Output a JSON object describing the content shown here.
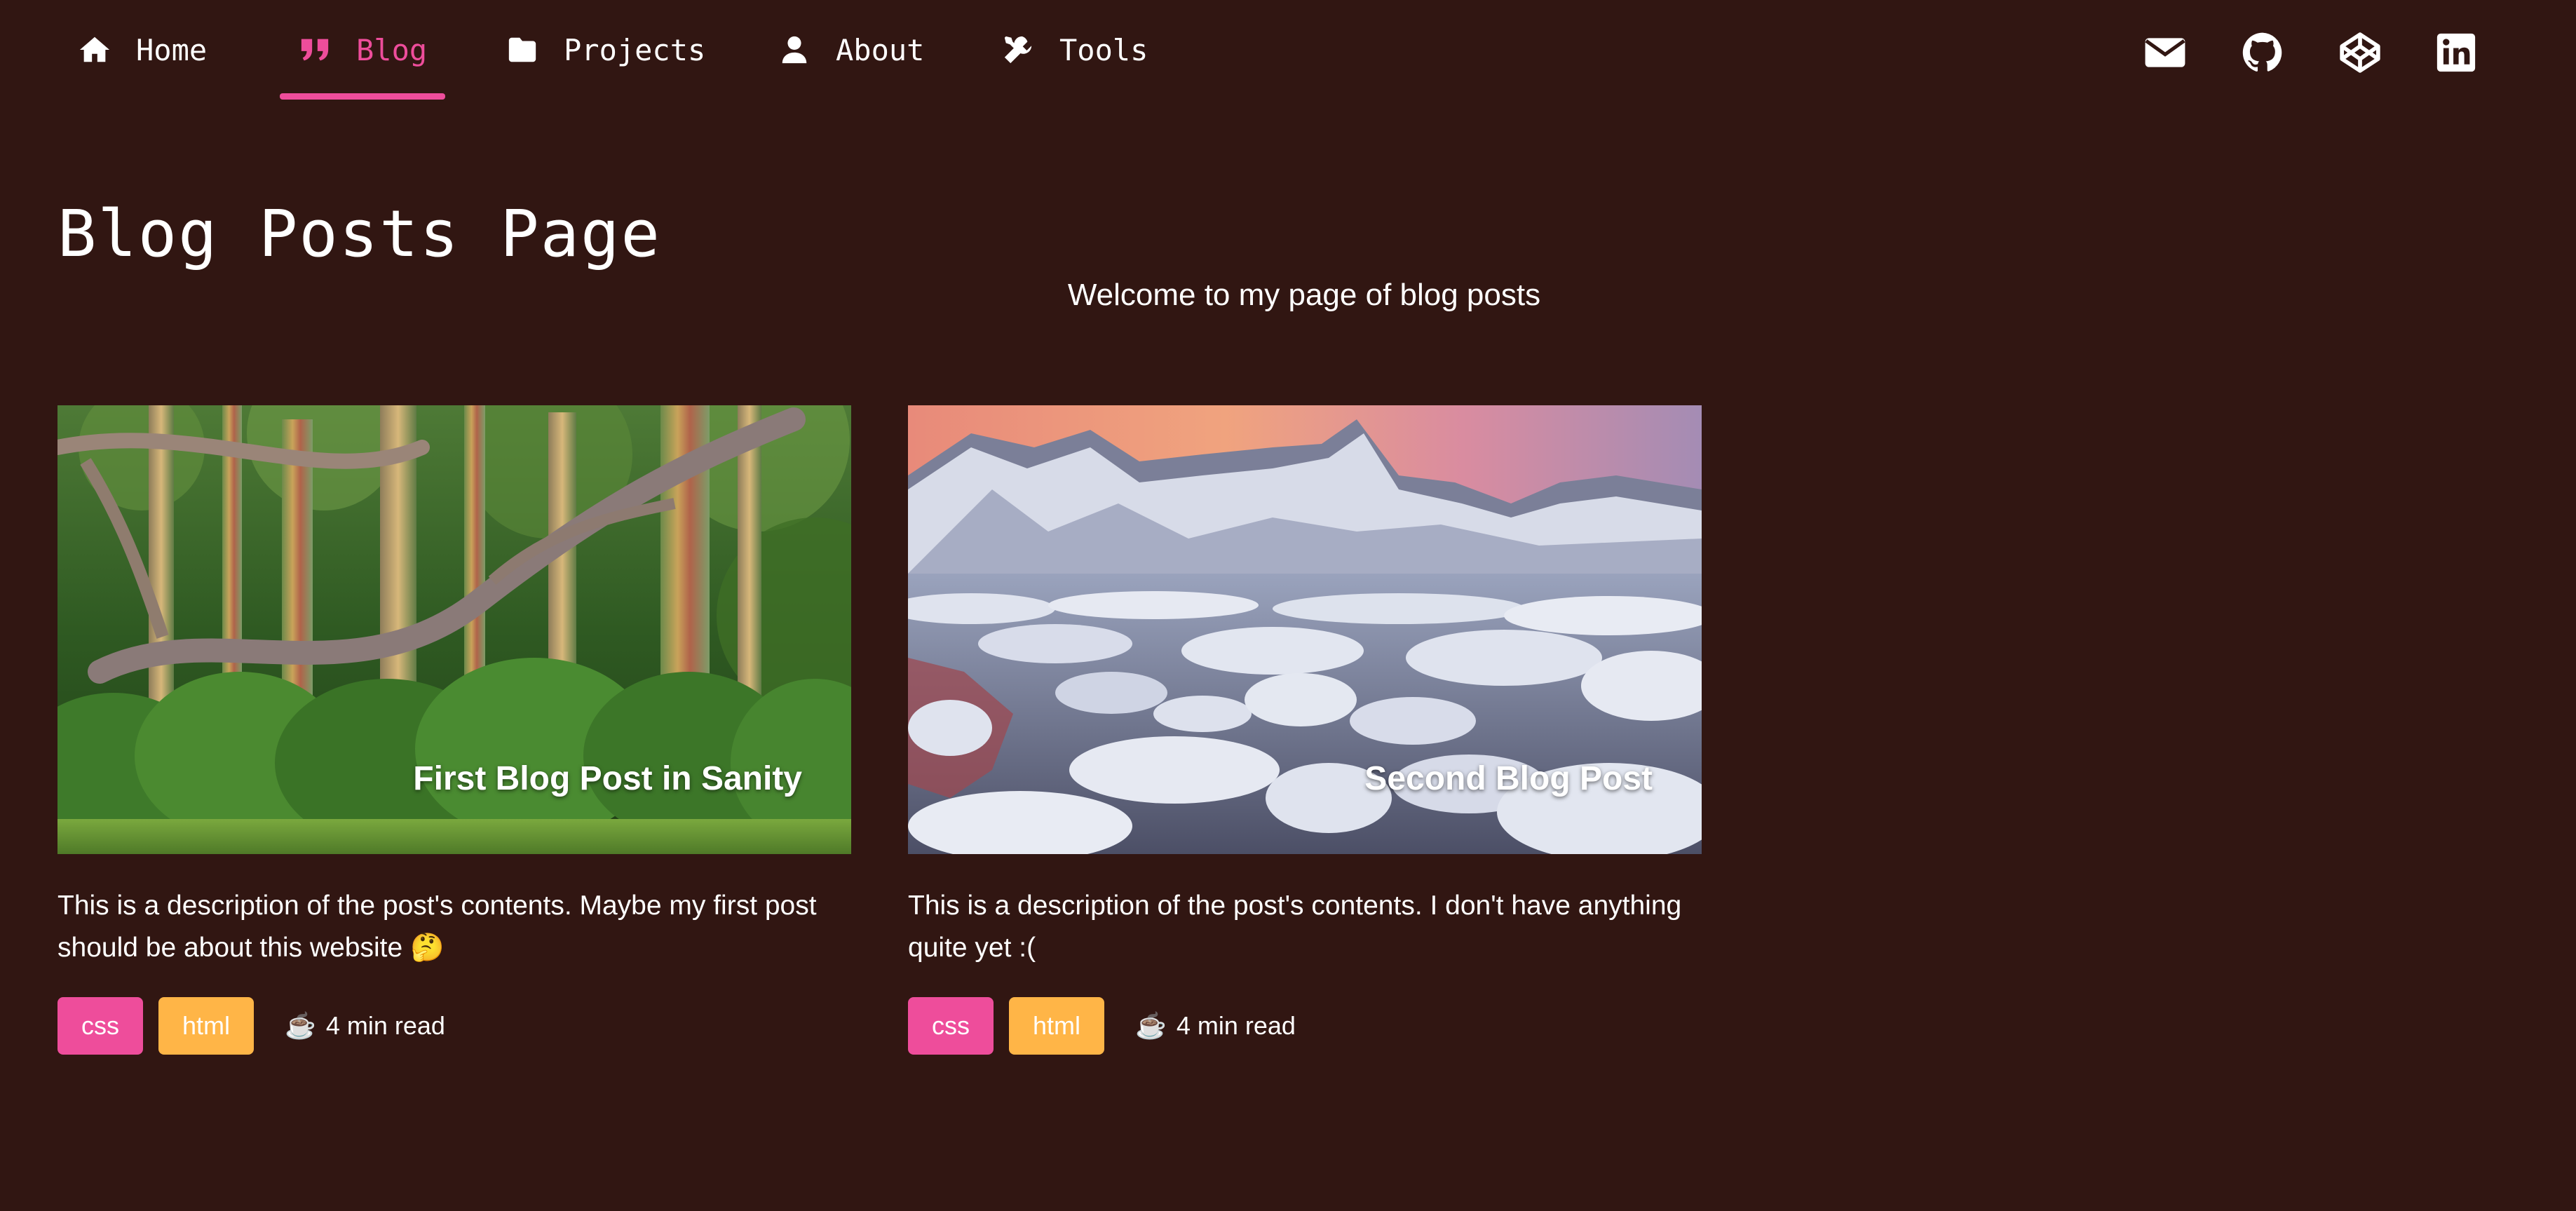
{
  "nav": {
    "items": [
      {
        "label": "Home",
        "icon": "home-icon"
      },
      {
        "label": "Blog",
        "icon": "quote-icon",
        "active": true
      },
      {
        "label": "Projects",
        "icon": "folder-icon"
      },
      {
        "label": "About",
        "icon": "user-icon"
      },
      {
        "label": "Tools",
        "icon": "tools-icon"
      }
    ],
    "social": [
      "mail-icon",
      "github-icon",
      "codepen-icon",
      "linkedin-icon"
    ]
  },
  "header": {
    "title": "Blog Posts Page",
    "subtitle": "Welcome to my page of blog posts"
  },
  "posts": [
    {
      "title": "First Blog Post in Sanity",
      "description": "This is a description of the post's contents. Maybe my first post should be about this website 🤔",
      "tags": [
        "css",
        "html"
      ],
      "read_time": "4 min read",
      "read_icon": "☕"
    },
    {
      "title": "Second Blog Post",
      "description": "This is a description of the post's contents. I don't have anything quite yet :(",
      "tags": [
        "css",
        "html"
      ],
      "read_time": "4 min read",
      "read_icon": "☕"
    }
  ],
  "colors": {
    "background": "#311612",
    "accent": "#ee4d9b",
    "tag_css": "#ee4d9b",
    "tag_html": "#ffb547",
    "text": "#ffffff"
  }
}
